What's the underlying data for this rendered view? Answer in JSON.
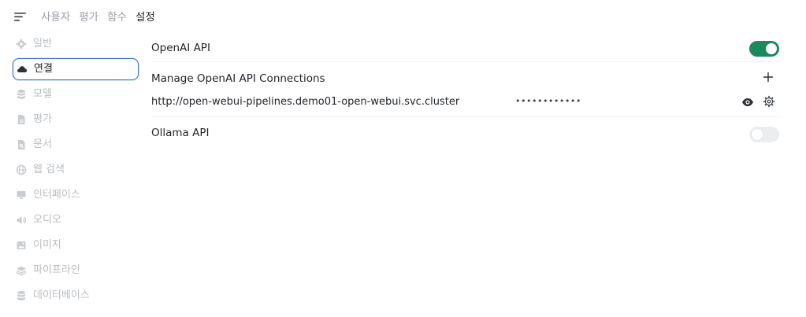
{
  "top_tabs": [
    {
      "label": "사용자"
    },
    {
      "label": "평가"
    },
    {
      "label": "함수"
    },
    {
      "label": "설정"
    }
  ],
  "active_top_tab": "설정",
  "sidebar": {
    "items": [
      {
        "label": "일반",
        "icon": "gear-icon"
      },
      {
        "label": "연결",
        "icon": "cloud-icon"
      },
      {
        "label": "모델",
        "icon": "database-icon"
      },
      {
        "label": "평가",
        "icon": "document-icon"
      },
      {
        "label": "문서",
        "icon": "document-search-icon"
      },
      {
        "label": "웹 검색",
        "icon": "globe-icon"
      },
      {
        "label": "인터페이스",
        "icon": "monitor-icon"
      },
      {
        "label": "오디오",
        "icon": "speaker-icon"
      },
      {
        "label": "이미지",
        "icon": "image-icon"
      },
      {
        "label": "파이프라인",
        "icon": "layers-icon"
      },
      {
        "label": "데이터베이스",
        "icon": "database-icon"
      }
    ],
    "active": "연결"
  },
  "openai": {
    "label": "OpenAI API",
    "enabled": true
  },
  "manage": {
    "label": "Manage OpenAI API Connections"
  },
  "connection": {
    "url": "http://open-webui-pipelines.demo01-open-webui.svc.cluster",
    "key_masked": "••••••••••••"
  },
  "ollama": {
    "label": "Ollama API",
    "enabled": false
  },
  "colors": {
    "accent": "#1a8a5a",
    "active_border": "#2f6ec5",
    "muted_text": "#b9bdc2"
  }
}
